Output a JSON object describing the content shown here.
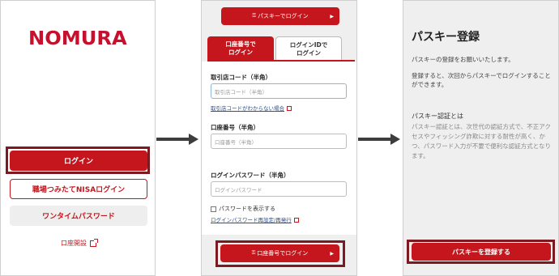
{
  "panel1": {
    "logo": "NOMURA",
    "login_button": "ログイン",
    "workplace_nisa_button": "職場つみたてNISAログイン",
    "onetime_password_button": "ワンタイムパスワード",
    "open_account_link": "口座開設"
  },
  "panel2": {
    "passkey_login_button": "パスキーでログイン",
    "tabs": [
      {
        "line1": "口座番号で",
        "line2": "ログイン",
        "active": true
      },
      {
        "line1": "ログインIDで",
        "line2": "ログイン",
        "active": false
      }
    ],
    "branch_code_label": "取引店コード（半角）",
    "branch_code_placeholder": "取引店コード（半角）",
    "branch_code_help": "取引店コードがわからない場合",
    "account_number_label": "口座番号（半角）",
    "account_number_placeholder": "口座番号（半角）",
    "password_label": "ログインパスワード（半角）",
    "password_placeholder": "ログインパスワード",
    "show_password": "パスワードを表示する",
    "password_reset_link": "ログインパスワード再設定/再発行",
    "account_login_button": "口座番号でログイン"
  },
  "panel3": {
    "title": "パスキー登録",
    "request_text": "パスキーの登録をお願いいたします。",
    "info_text": "登録すると、次回からパスキーでログインすることができます。",
    "subtitle": "パスキー認証とは",
    "description": "パスキー認証とは、次世代の認証方式で、不正アクセスやフィッシング詐欺に対する耐性が高く、かつ、パスワード入力が不要で便利な認証方式となります。",
    "register_button": "パスキーを登録する"
  },
  "colors": {
    "brand_red": "#c5161d",
    "highlight_border": "#7d1a1f",
    "panel_gray": "#efefef"
  },
  "icons": [
    "external-link-icon",
    "passkey-icon",
    "chevron-right-icon",
    "arrow-right-icon",
    "checkbox-icon"
  ]
}
